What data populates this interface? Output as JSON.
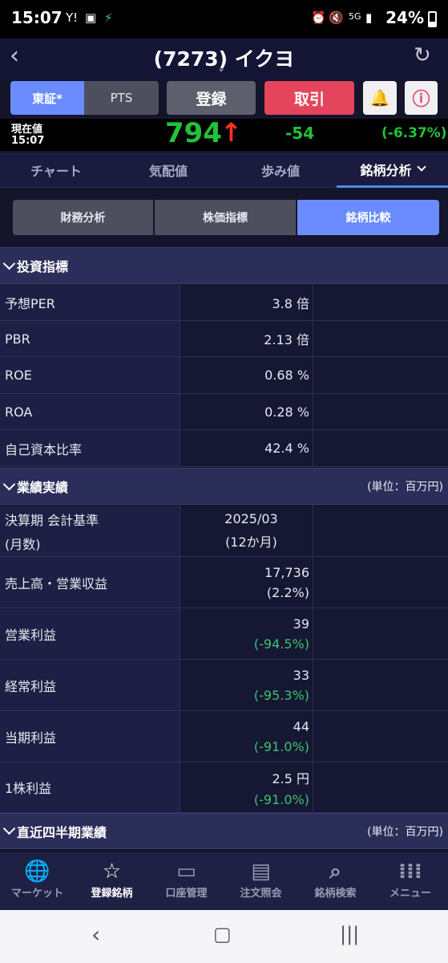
{
  "status": {
    "time": "15:07",
    "battery": "24%",
    "net": "5G"
  },
  "header": {
    "title": "(7273) イクヨ"
  },
  "market_buttons": {
    "tse": "東証*",
    "pts": "PTS",
    "register": "登録",
    "trade": "取引"
  },
  "quote": {
    "label1": "現在値",
    "label2": "15:07",
    "price": "794",
    "arrow": "↑",
    "change": "-54",
    "change_pct": "(-6.37%)"
  },
  "tabs": [
    "チャート",
    "気配値",
    "歩み値",
    "銘柄分析"
  ],
  "segments": [
    "財務分析",
    "株価指標",
    "銘柄比較"
  ],
  "section1": {
    "title": "投資指標"
  },
  "indicators": [
    {
      "label": "予想PER",
      "value": "3.8 倍"
    },
    {
      "label": "PBR",
      "value": "2.13 倍"
    },
    {
      "label": "ROE",
      "value": "0.68 %"
    },
    {
      "label": "ROA",
      "value": "0.28 %"
    },
    {
      "label": "自己資本比率",
      "value": "42.4 %"
    }
  ],
  "section2": {
    "title": "業績実績",
    "unit": "(単位：百万円)"
  },
  "period": {
    "label1": "決算期 会計基準",
    "label2": "(月数)",
    "value1": "2025/03",
    "value2": "(12か月)"
  },
  "results": [
    {
      "label": "売上高・営業収益",
      "value": "17,736",
      "sub": "(2.2%)",
      "sub_green": false
    },
    {
      "label": "営業利益",
      "value": "39",
      "sub": "(-94.5%)",
      "sub_green": true
    },
    {
      "label": "経常利益",
      "value": "33",
      "sub": "(-95.3%)",
      "sub_green": true
    },
    {
      "label": "当期利益",
      "value": "44",
      "sub": "(-91.0%)",
      "sub_green": true
    },
    {
      "label": "1株利益",
      "value": "2.5 円",
      "sub": "(-91.0%)",
      "sub_green": true
    }
  ],
  "section3": {
    "title": "直近四半期業績",
    "unit": "(単位：百万円)"
  },
  "bottom_nav": [
    "マーケット",
    "登録銘柄",
    "口座管理",
    "注文照会",
    "銘柄検索",
    "メニュー"
  ],
  "colors": {
    "accent": "#6b8cff",
    "trade": "#e5445d",
    "up": "#22c23a",
    "down": "#3dc46a"
  }
}
